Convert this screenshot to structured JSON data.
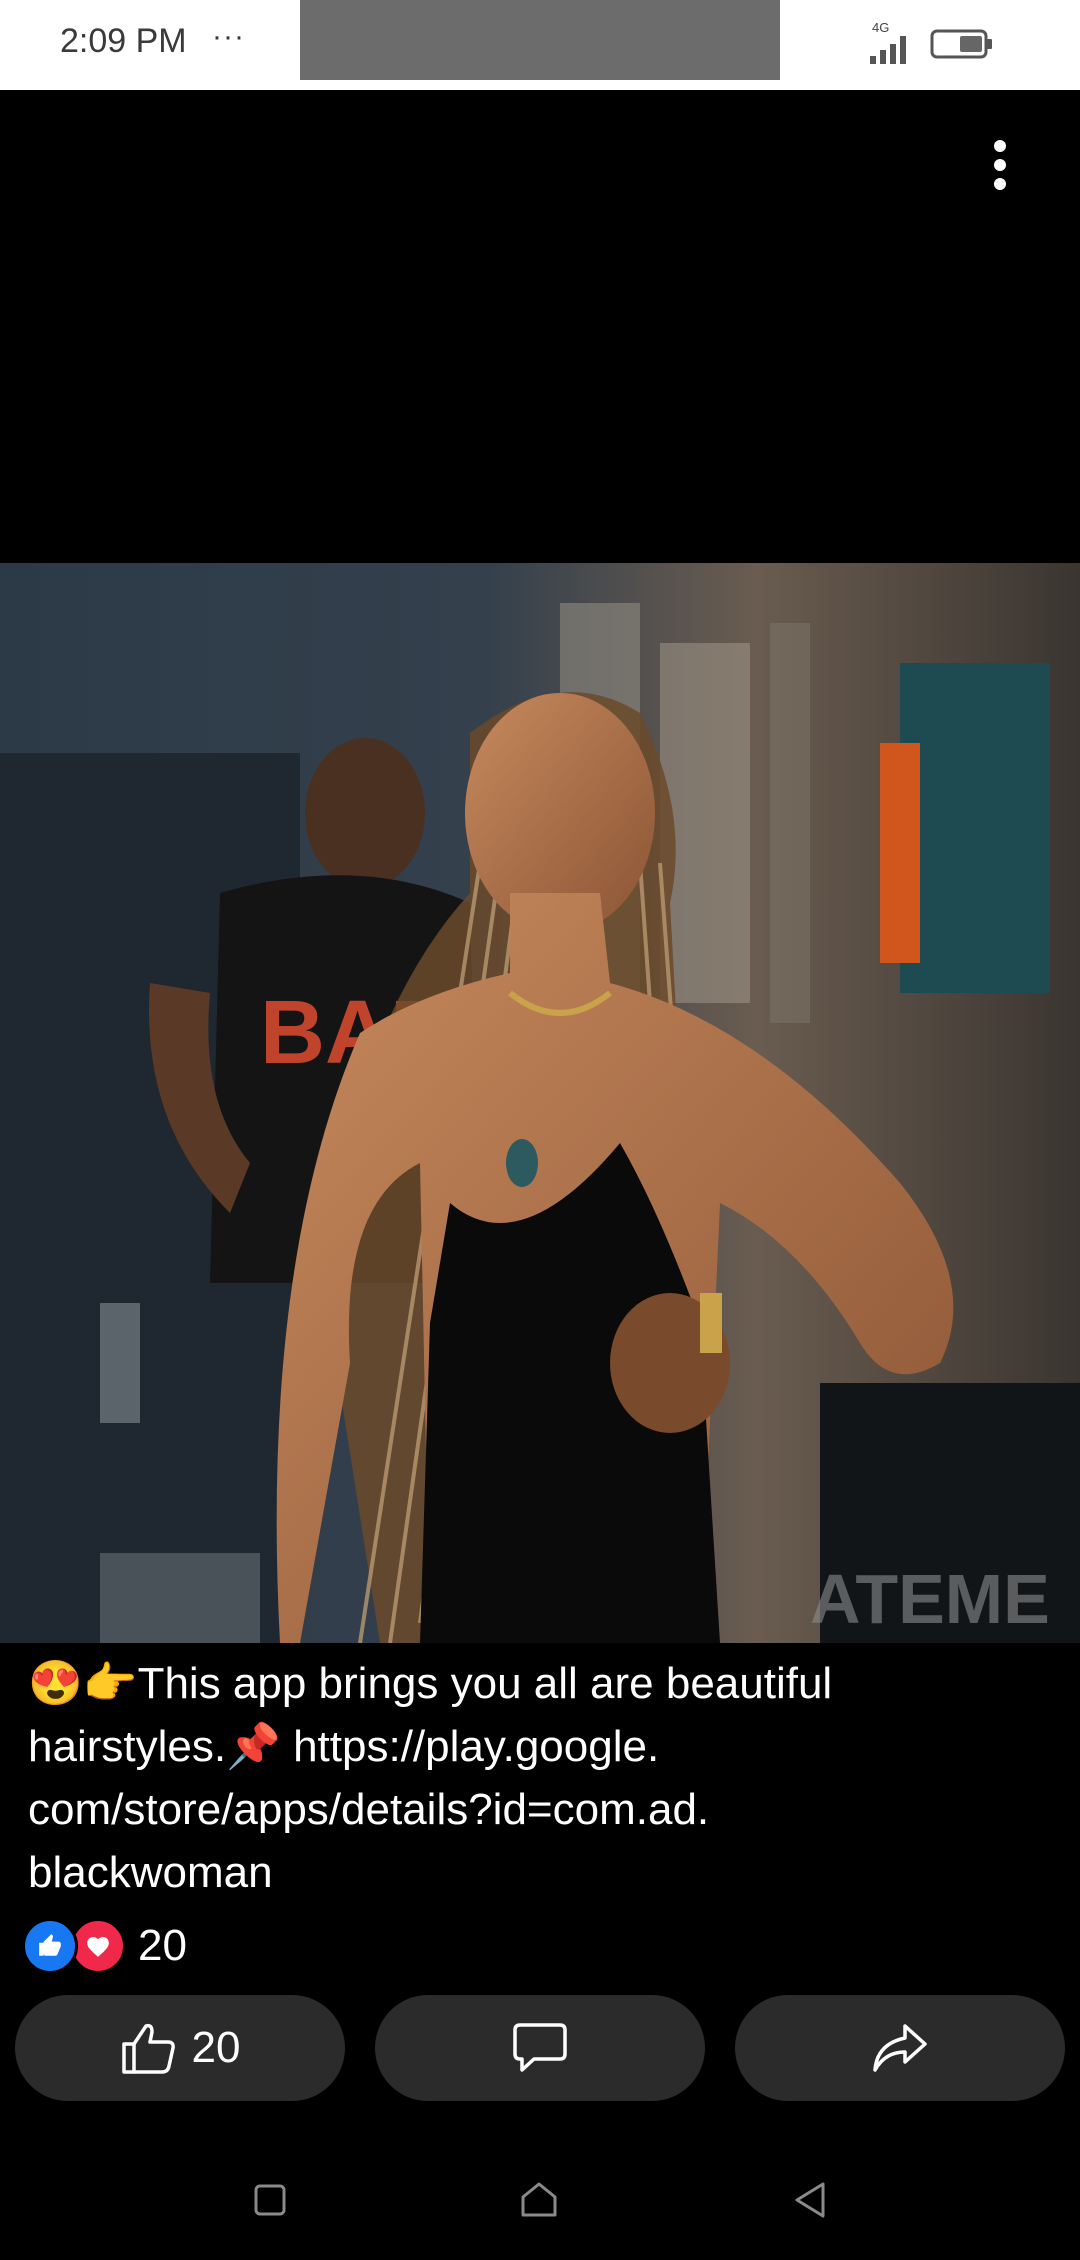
{
  "status_bar": {
    "time": "2:09 PM",
    "overflow": "···",
    "network": "4G",
    "icons": [
      "signal-icon",
      "battery-icon"
    ]
  },
  "post": {
    "menu_icon": "more-vertical-icon",
    "photo_alt_icon": "photo",
    "caption": "😍👉This app brings you all are beautiful\nhairstyles.📌 https://play.google.\ncom/store/apps/details?id=com.ad.\nblackwoman",
    "reactions": {
      "icons": [
        "like-reaction-icon",
        "love-reaction-icon"
      ],
      "count": "20"
    },
    "actions": {
      "like_count": "20",
      "like_icon": "thumbs-up-icon",
      "comment_icon": "comment-icon",
      "share_icon": "share-icon"
    }
  },
  "nav_bar": {
    "icons": [
      "recent-apps-icon",
      "home-icon",
      "back-icon"
    ]
  },
  "colors": {
    "background": "#000000",
    "button_bg": "#2b2b2b",
    "like_blue": "#1877f2",
    "love_red": "#f0284a",
    "status_bar_bg": "#ffffff"
  }
}
